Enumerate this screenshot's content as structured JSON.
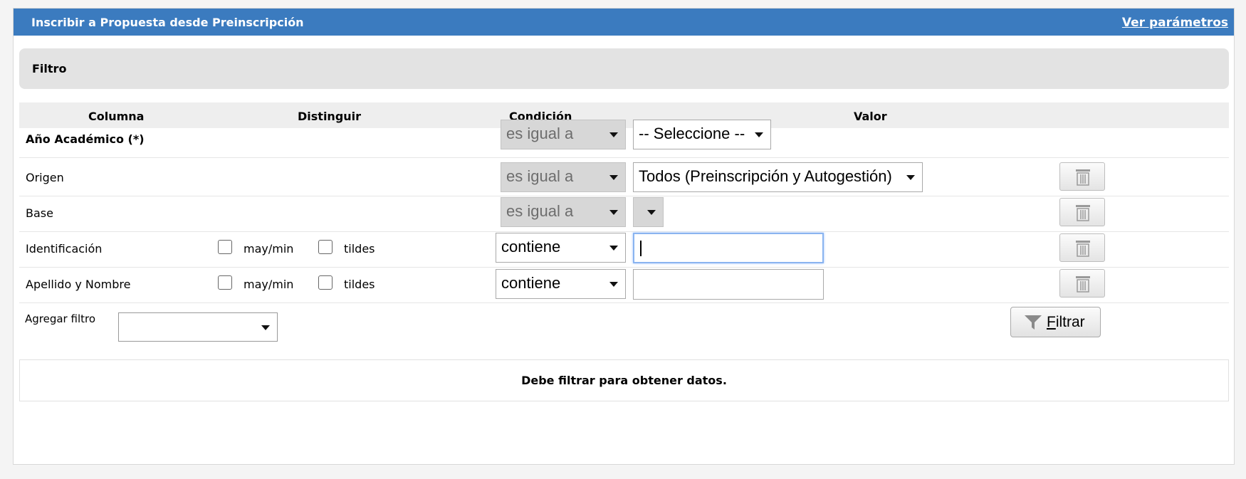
{
  "header": {
    "title": "Inscribir a Propuesta desde Preinscripción",
    "params_link": "Ver parámetros"
  },
  "filter_section": {
    "title": "Filtro"
  },
  "columns": {
    "columna": "Columna",
    "distinguir": "Distinguir",
    "condicion": "Condición",
    "valor": "Valor"
  },
  "rows": [
    {
      "label": "Año Académico (*)",
      "condition": "es igual a",
      "value": "-- Seleccione --"
    },
    {
      "label": "Origen",
      "condition": "es igual a",
      "value": "Todos (Preinscripción y Autogestión)"
    },
    {
      "label": "Base",
      "condition": "es igual a",
      "value": ""
    },
    {
      "label": "Identificación",
      "case_label": "may/min",
      "accent_label": "tildes",
      "condition": "contiene",
      "value": ""
    },
    {
      "label": "Apellido y Nombre",
      "case_label": "may/min",
      "accent_label": "tildes",
      "condition": "contiene",
      "value": ""
    }
  ],
  "add_filter": {
    "label": "Agregar filtro",
    "value": ""
  },
  "filter_button": {
    "label": "Filtrar"
  },
  "message": "Debe filtrar para obtener datos.",
  "icons": {
    "delete": "trash-icon",
    "filter": "funnel-icon"
  }
}
